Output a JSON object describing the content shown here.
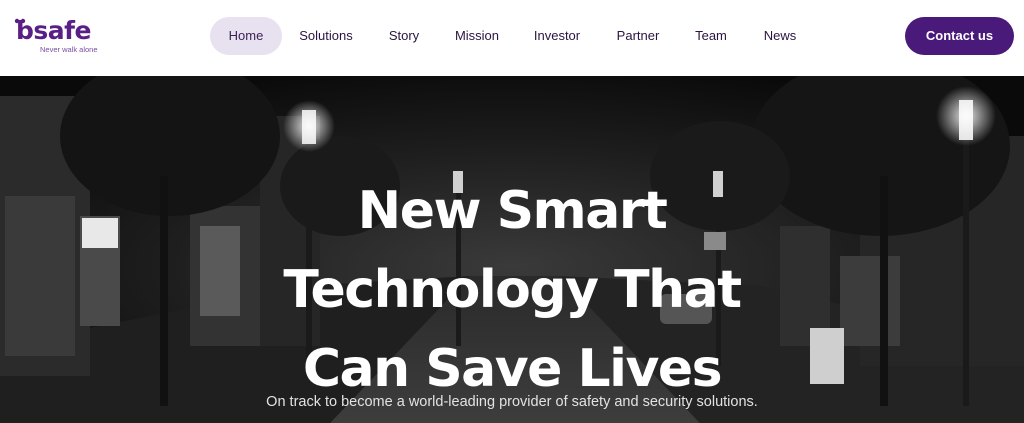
{
  "brand": {
    "name": "bsafe",
    "tagline": "Never walk alone",
    "color": "#5a1f86"
  },
  "nav": {
    "items": [
      {
        "label": "Home",
        "active": true
      },
      {
        "label": "Solutions"
      },
      {
        "label": "Story"
      },
      {
        "label": "Mission"
      },
      {
        "label": "Investor"
      },
      {
        "label": "Partner"
      },
      {
        "label": "Team"
      },
      {
        "label": "News"
      }
    ],
    "active_bg": "#e8e1f0"
  },
  "cta": {
    "label": "Contact us",
    "color": "#4a1a7a"
  },
  "hero": {
    "title_lines": [
      "New Smart",
      "Technology That",
      "Can Save Lives"
    ],
    "subtitle": "On track to become a world-leading provider of safety and security solutions.",
    "background": "night-street-photo"
  }
}
